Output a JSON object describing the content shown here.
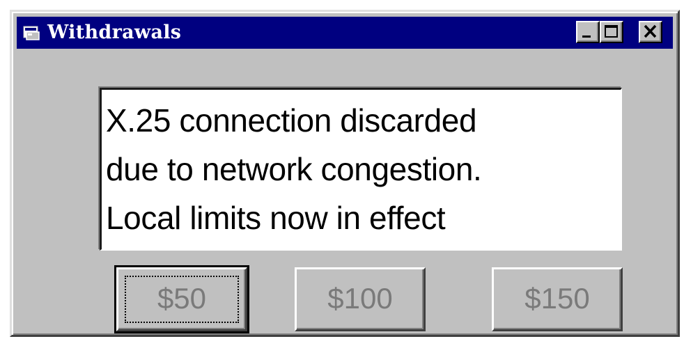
{
  "window": {
    "title": "Withdrawals",
    "icon": "app-window-icon",
    "controls": {
      "minimize": "minimize-icon",
      "maximize": "maximize-icon",
      "close": "close-icon"
    }
  },
  "message": {
    "lines": [
      "X.25 connection discarded",
      "due to network congestion.",
      "Local limits now in effect"
    ]
  },
  "buttons": [
    {
      "label": "$50",
      "focused": true,
      "enabled": false
    },
    {
      "label": "$100",
      "focused": false,
      "enabled": false
    },
    {
      "label": "$150",
      "focused": false,
      "enabled": false
    }
  ],
  "colors": {
    "titlebar": "#000080",
    "face": "#c0c0c0",
    "disabled_text": "#7a7a7a"
  }
}
